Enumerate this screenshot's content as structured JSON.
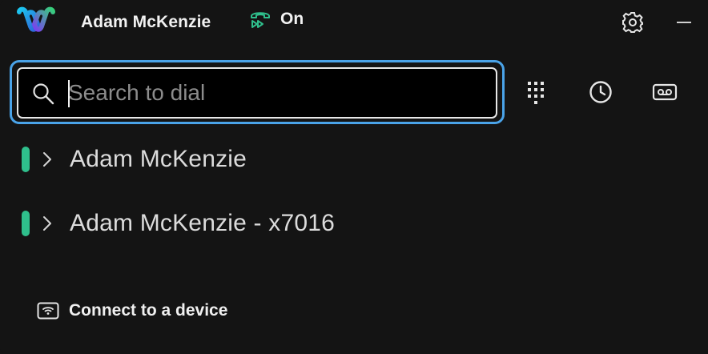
{
  "header": {
    "user_name": "Adam McKenzie",
    "status_label": "On",
    "logo_icon": "webex-logo",
    "status_icon": "call-forward-icon",
    "settings_icon": "gear-icon",
    "minimize_icon": "minimize-icon"
  },
  "search": {
    "placeholder": "Search to dial",
    "value": ""
  },
  "toolbar": {
    "dialpad_icon": "dialpad-icon",
    "history_icon": "clock-icon",
    "voicemail_icon": "voicemail-icon"
  },
  "results": [
    {
      "label": "Adam McKenzie",
      "presence_color": "#2fbf8c"
    },
    {
      "label": "Adam McKenzie - x7016",
      "presence_color": "#2fbf8c"
    }
  ],
  "footer": {
    "connect_label": "Connect to a device",
    "connect_icon": "device-connect-icon"
  },
  "colors": {
    "background": "#141414",
    "accent_focus": "#4aa3e8",
    "presence_green": "#2fbf8c"
  }
}
